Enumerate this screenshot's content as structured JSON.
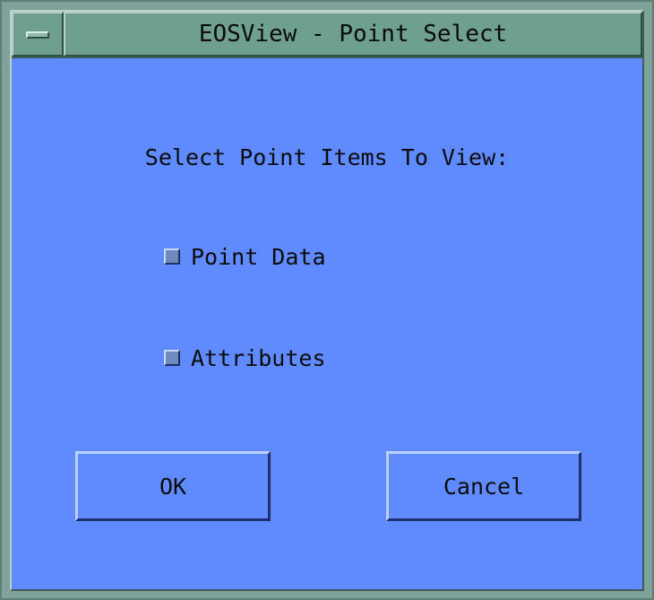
{
  "window": {
    "title": "EOSView - Point Select"
  },
  "dialog": {
    "prompt": "Select Point Items To View:",
    "options": [
      {
        "label": "Point Data",
        "checked": false
      },
      {
        "label": "Attributes",
        "checked": false
      }
    ],
    "buttons": {
      "ok_label": "OK",
      "cancel_label": "Cancel"
    }
  },
  "colors": {
    "background": "#5f8bff",
    "titlebar": "#6f9f91",
    "text": "#0b0b0b"
  },
  "icons": {
    "window_menu": "window-menu-icon"
  }
}
